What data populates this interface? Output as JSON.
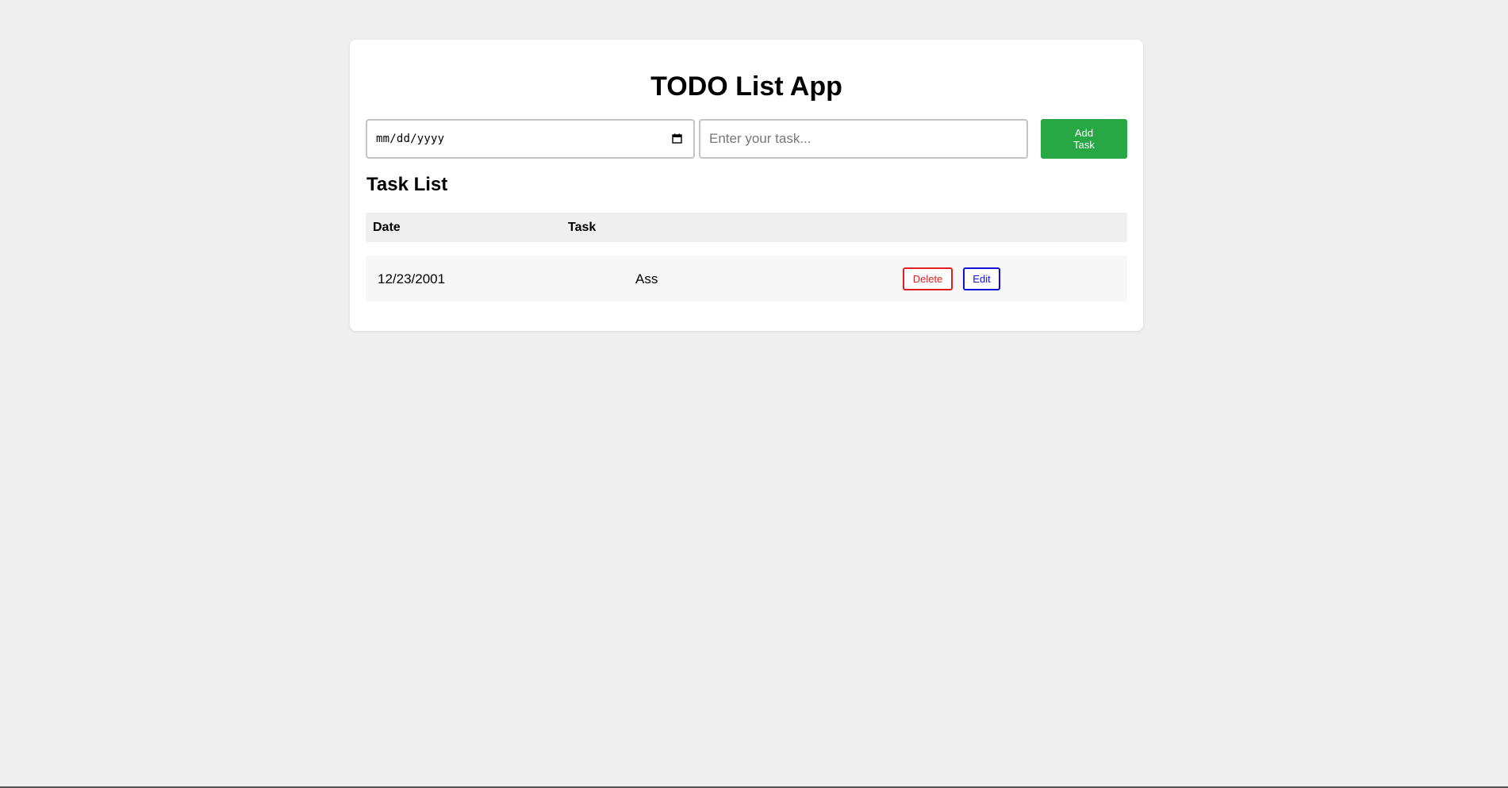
{
  "app": {
    "title": "TODO List App"
  },
  "form": {
    "date_placeholder": "mm/dd/yyyy",
    "task_placeholder": "Enter your task...",
    "add_button_label": "Add Task"
  },
  "task_list": {
    "heading": "Task List",
    "columns": {
      "date": "Date",
      "task": "Task"
    },
    "rows": [
      {
        "date": "12/23/2001",
        "task": "Ass",
        "delete_label": "Delete",
        "edit_label": "Edit"
      }
    ]
  },
  "icons": {
    "date_picker": "calendar-icon"
  },
  "colors": {
    "add_button": "#28a745",
    "delete": "#e02020",
    "edit": "#1010d8",
    "background": "#efefef"
  }
}
